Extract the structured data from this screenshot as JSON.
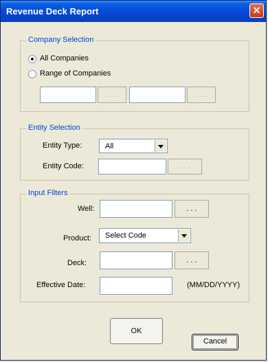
{
  "window": {
    "title": "Revenue Deck Report",
    "close_glyph": "✕"
  },
  "company_selection": {
    "legend": "Company Selection",
    "all_companies": "All Companies",
    "range_of_companies": "Range of Companies",
    "from_ellipsis": ". . .",
    "to_ellipsis": ". . .",
    "selected": "all"
  },
  "entity_selection": {
    "legend": "Entity Selection",
    "type_label": "Entity Type:",
    "type_value": "All",
    "code_label": "Entity Code:",
    "code_ellipsis": ". . ."
  },
  "input_filters": {
    "legend": "Input Filters",
    "well_label": "Well:",
    "well_ellipsis": ". . .",
    "product_label": "Product:",
    "product_value": "Select Code",
    "deck_label": "Deck:",
    "deck_ellipsis": ". . .",
    "date_label": "Effective Date:",
    "date_format": "(MM/DD/YYYY)"
  },
  "buttons": {
    "ok": "OK",
    "cancel": "Cancel"
  }
}
